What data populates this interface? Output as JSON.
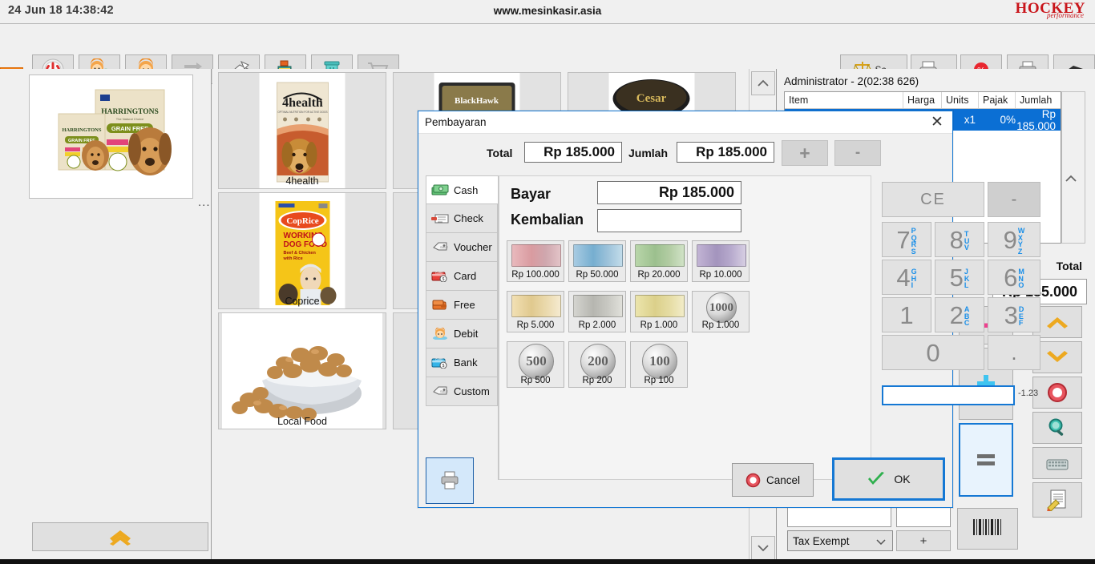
{
  "topbar": {
    "date": "24 Jun 18  14:38:42",
    "site_title": "www.mesinkasir.asia",
    "brand_main": "HOCKEY",
    "brand_sub": "performance"
  },
  "toolbar": {
    "left_buttons": [
      {
        "name": "power-button",
        "icon": "power-icon",
        "label": ""
      },
      {
        "name": "user-login-button",
        "icon": "user-check-icon",
        "label": ""
      },
      {
        "name": "user-button",
        "icon": "user-icon",
        "label": ""
      },
      {
        "name": "exchange-button",
        "icon": "exchange-arrows-icon",
        "label": "",
        "disabled": true
      },
      {
        "name": "mail-button",
        "icon": "envelope-icon",
        "label": ""
      },
      {
        "name": "cash-register-button",
        "icon": "cash-register-icon",
        "label": ""
      },
      {
        "name": "trash-button",
        "icon": "trash-icon",
        "label": ""
      },
      {
        "name": "cart-button",
        "icon": "shopping-cart-icon",
        "label": "",
        "disabled": true
      }
    ],
    "right_buttons": [
      {
        "name": "scale-button",
        "icon": "scale-icon",
        "label": "Sc..."
      },
      {
        "name": "printer-options-button",
        "icon": "printer-icon",
        "label": "..."
      },
      {
        "name": "discount-button",
        "icon": "percent-badge-icon",
        "label": ""
      },
      {
        "name": "print-button",
        "icon": "printer-icon",
        "label": ""
      },
      {
        "name": "drawer-button",
        "icon": "drawer-icon",
        "label": ""
      }
    ]
  },
  "left_panel": {
    "expand_tab": "left-expand-tab",
    "preview_product": "Harringtons Grain Free Selection Box",
    "more_dots": "...",
    "scroll_up_label": "scroll-up"
  },
  "products": [
    {
      "name": "4health",
      "label": "4health"
    },
    {
      "name": "blackhawk",
      "label": ""
    },
    {
      "name": "cesar",
      "label": ""
    },
    {
      "name": "coprice",
      "label": "Coprice"
    },
    {
      "name": "product-5",
      "label": ""
    },
    {
      "name": "local-food",
      "label": "Local Food"
    },
    {
      "name": "product-7",
      "label": ""
    }
  ],
  "right_panel": {
    "admin_line": "Administrator -  2(02:38 626)",
    "cart_headers": [
      "Item",
      "Harga",
      "Units",
      "Pajak",
      "Jumlah"
    ],
    "cart_rows": [
      {
        "item": "",
        "harga": "",
        "units": "x1",
        "pajak": "0%",
        "jumlah": "Rp 185.000"
      }
    ],
    "total_label": "Total",
    "total_value": "Rp 185.000",
    "tax_option": "Tax Exempt",
    "add_label": "+",
    "op_buttons": [
      {
        "name": "minus-button",
        "icon": "minus-icon"
      },
      {
        "name": "plus-button",
        "icon": "plus-icon"
      },
      {
        "name": "equals-button",
        "icon": "equals-icon",
        "selected": true
      },
      {
        "name": "barcode-button",
        "icon": "barcode-icon"
      }
    ],
    "side_buttons": [
      {
        "name": "scroll-up-button",
        "icon": "chevron-up-icon"
      },
      {
        "name": "scroll-down-button",
        "icon": "chevron-down-icon"
      },
      {
        "name": "void-button",
        "icon": "cancel-circle-icon"
      },
      {
        "name": "search-button",
        "icon": "magnifier-icon"
      },
      {
        "name": "keyboard-button",
        "icon": "keyboard-icon"
      },
      {
        "name": "note-button",
        "icon": "document-edit-icon"
      }
    ]
  },
  "modal": {
    "title": "Pembayaran",
    "close": "✕",
    "total_label": "Total",
    "total_value": "Rp 185.000",
    "jumlah_label": "Jumlah",
    "jumlah_value": "Rp 185.000",
    "plus_label": "+",
    "minus_label": "-",
    "payment_tabs": [
      {
        "label": "Cash",
        "icon": "banknote-icon",
        "active": true
      },
      {
        "label": "Check",
        "icon": "cheque-icon",
        "active": false
      },
      {
        "label": "Voucher",
        "icon": "tag-icon",
        "active": false
      },
      {
        "label": "Card",
        "icon": "credit-card-icon",
        "active": false
      },
      {
        "label": "Free",
        "icon": "wallet-icon",
        "active": false
      },
      {
        "label": "Debit",
        "icon": "person-icon",
        "active": false
      },
      {
        "label": "Bank",
        "icon": "bank-card-icon",
        "active": false
      },
      {
        "label": "Custom",
        "icon": "tag-icon",
        "active": false
      }
    ],
    "bayar_label": "Bayar",
    "bayar_value": "Rp 185.000",
    "kembalian_label": "Kembalian",
    "kembalian_value": "",
    "denominations": [
      {
        "label": "Rp 100.000",
        "type": "bill",
        "color": "#e8b8bc"
      },
      {
        "label": "Rp 50.000",
        "type": "bill",
        "color": "#9fc8e0"
      },
      {
        "label": "Rp 20.000",
        "type": "bill",
        "color": "#b4d2a6"
      },
      {
        "label": "Rp 10.000",
        "type": "bill",
        "color": "#bcaed0"
      },
      {
        "label": "Rp 5.000",
        "type": "bill",
        "color": "#f0dcae"
      },
      {
        "label": "Rp 2.000",
        "type": "bill",
        "color": "#cbcbc6"
      },
      {
        "label": "Rp 1.000",
        "type": "bill",
        "color": "#e6dfa8"
      },
      {
        "label": "Rp 1.000",
        "type": "coin",
        "face": "1000"
      },
      {
        "label": "Rp 500",
        "type": "coin",
        "face": "500"
      },
      {
        "label": "Rp 200",
        "type": "coin",
        "face": "200"
      },
      {
        "label": "Rp 100",
        "type": "coin",
        "face": "100"
      }
    ],
    "keypad": {
      "ce_label": "CE",
      "backspace_label": "-",
      "keys": [
        {
          "num": "7",
          "letters": "PQRS"
        },
        {
          "num": "8",
          "letters": "TUV"
        },
        {
          "num": "9",
          "letters": "WXYZ"
        },
        {
          "num": "4",
          "letters": "GHI"
        },
        {
          "num": "5",
          "letters": "JKL"
        },
        {
          "num": "6",
          "letters": "MNO"
        },
        {
          "num": "1",
          "letters": ""
        },
        {
          "num": "2",
          "letters": "ABC"
        },
        {
          "num": "3",
          "letters": "DEF"
        },
        {
          "num": "0",
          "letters": ""
        },
        {
          "num": ".",
          "letters": ""
        }
      ],
      "input_value": "",
      "note": "-1.23"
    },
    "print_button": "print-receipt-button",
    "cancel_label": "Cancel",
    "ok_label": "OK"
  },
  "colors": {
    "accent_blue": "#1578d4",
    "selection_blue": "#0b6fd4",
    "orange": "#f07d13",
    "brand_red": "#c9151b"
  }
}
